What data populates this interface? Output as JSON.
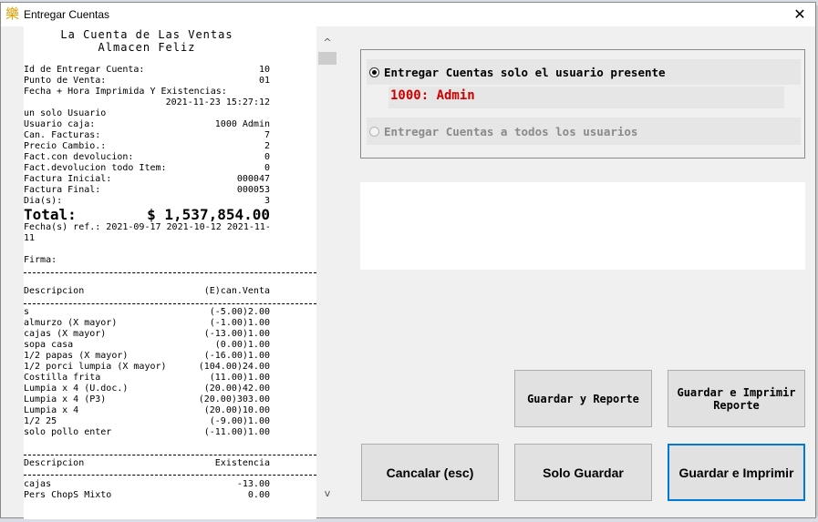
{
  "window": {
    "title": "Entregar Cuentas",
    "icon_glyph": "樂",
    "close_glyph": "✕"
  },
  "receipt": {
    "header1": "La Cuenta de Las Ventas",
    "header2": "Almacen Feliz",
    "fields": [
      {
        "label": "Id de Entregar Cuenta:",
        "value": "10"
      },
      {
        "label": "Punto de Venta:",
        "value": "01"
      }
    ],
    "printed_label": "Fecha + Hora Imprimida Y Existencias:",
    "printed_value": "2021-11-23 15:27:12",
    "mode": "un solo Usuario",
    "details": [
      {
        "label": "Usuario caja:",
        "value": "1000 Admin"
      },
      {
        "label": "Can. Facturas:",
        "value": "7"
      },
      {
        "label": "Precio Cambio.:",
        "value": "2"
      },
      {
        "label": "Fact.con devolucion:",
        "value": "0"
      },
      {
        "label": "Fact.devolucion todo Item:",
        "value": "0"
      },
      {
        "label": "Factura Inicial:",
        "value": "000047"
      },
      {
        "label": "Factura Final:",
        "value": "000053"
      },
      {
        "label": "Dia(s):",
        "value": "3"
      }
    ],
    "total_label": "Total:",
    "total_value": "$ 1,537,854.00",
    "ref_dates_line1": "Fecha(s) ref.: 2021-09-17 2021-10-12 2021-11-",
    "ref_dates_line2": "11",
    "firma": "Firma:",
    "sales_header": {
      "desc": "Descripcion",
      "col": "(E)can.Venta"
    },
    "sales_items": [
      {
        "desc": "s",
        "value": "(-5.00)2.00"
      },
      {
        "desc": "almurzo (X mayor)",
        "value": "(-1.00)1.00"
      },
      {
        "desc": "cajas (X mayor)",
        "value": "(-13.00)1.00"
      },
      {
        "desc": "sopa casa",
        "value": "(0.00)1.00"
      },
      {
        "desc": "1/2 papas (X mayor)",
        "value": "(-16.00)1.00"
      },
      {
        "desc": "1/2 porci lumpia (X mayor)",
        "value": "(104.00)24.00"
      },
      {
        "desc": "Costilla frita",
        "value": "(11.00)1.00"
      },
      {
        "desc": "Lumpia x 4 (U.doc.)",
        "value": "(20.00)42.00"
      },
      {
        "desc": "Lumpia x 4 (P3)",
        "value": "(20.00)303.00"
      },
      {
        "desc": "Lumpia x 4",
        "value": "(20.00)10.00"
      },
      {
        "desc": "1/2 25",
        "value": "(-9.00)1.00"
      },
      {
        "desc": "solo pollo enter",
        "value": "(-11.00)1.00"
      }
    ],
    "stock_header": {
      "desc": "Descripcion",
      "col": "Existencia"
    },
    "stock_items": [
      {
        "desc": "cajas",
        "value": "-13.00"
      },
      {
        "desc": "Pers ChopS Mixto",
        "value": "0.00"
      }
    ]
  },
  "scrollbar": {
    "up_glyph": "^",
    "down_glyph": "v"
  },
  "options": {
    "present_user_label": "Entregar Cuentas solo el usuario presente",
    "present_user_value": "1000: Admin",
    "all_users_label": "Entregar Cuentas a todos los usuarios",
    "selected": "present_user"
  },
  "buttons": {
    "save_report": "Guardar y Reporte",
    "save_print_report": "Guardar e Imprimir\nReporte",
    "cancel": "Cancalar (esc)",
    "save_only": "Solo Guardar",
    "save_print": "Guardar e Imprimir"
  },
  "colors": {
    "user_text": "#cc0000",
    "focus_border": "#0078d7"
  }
}
